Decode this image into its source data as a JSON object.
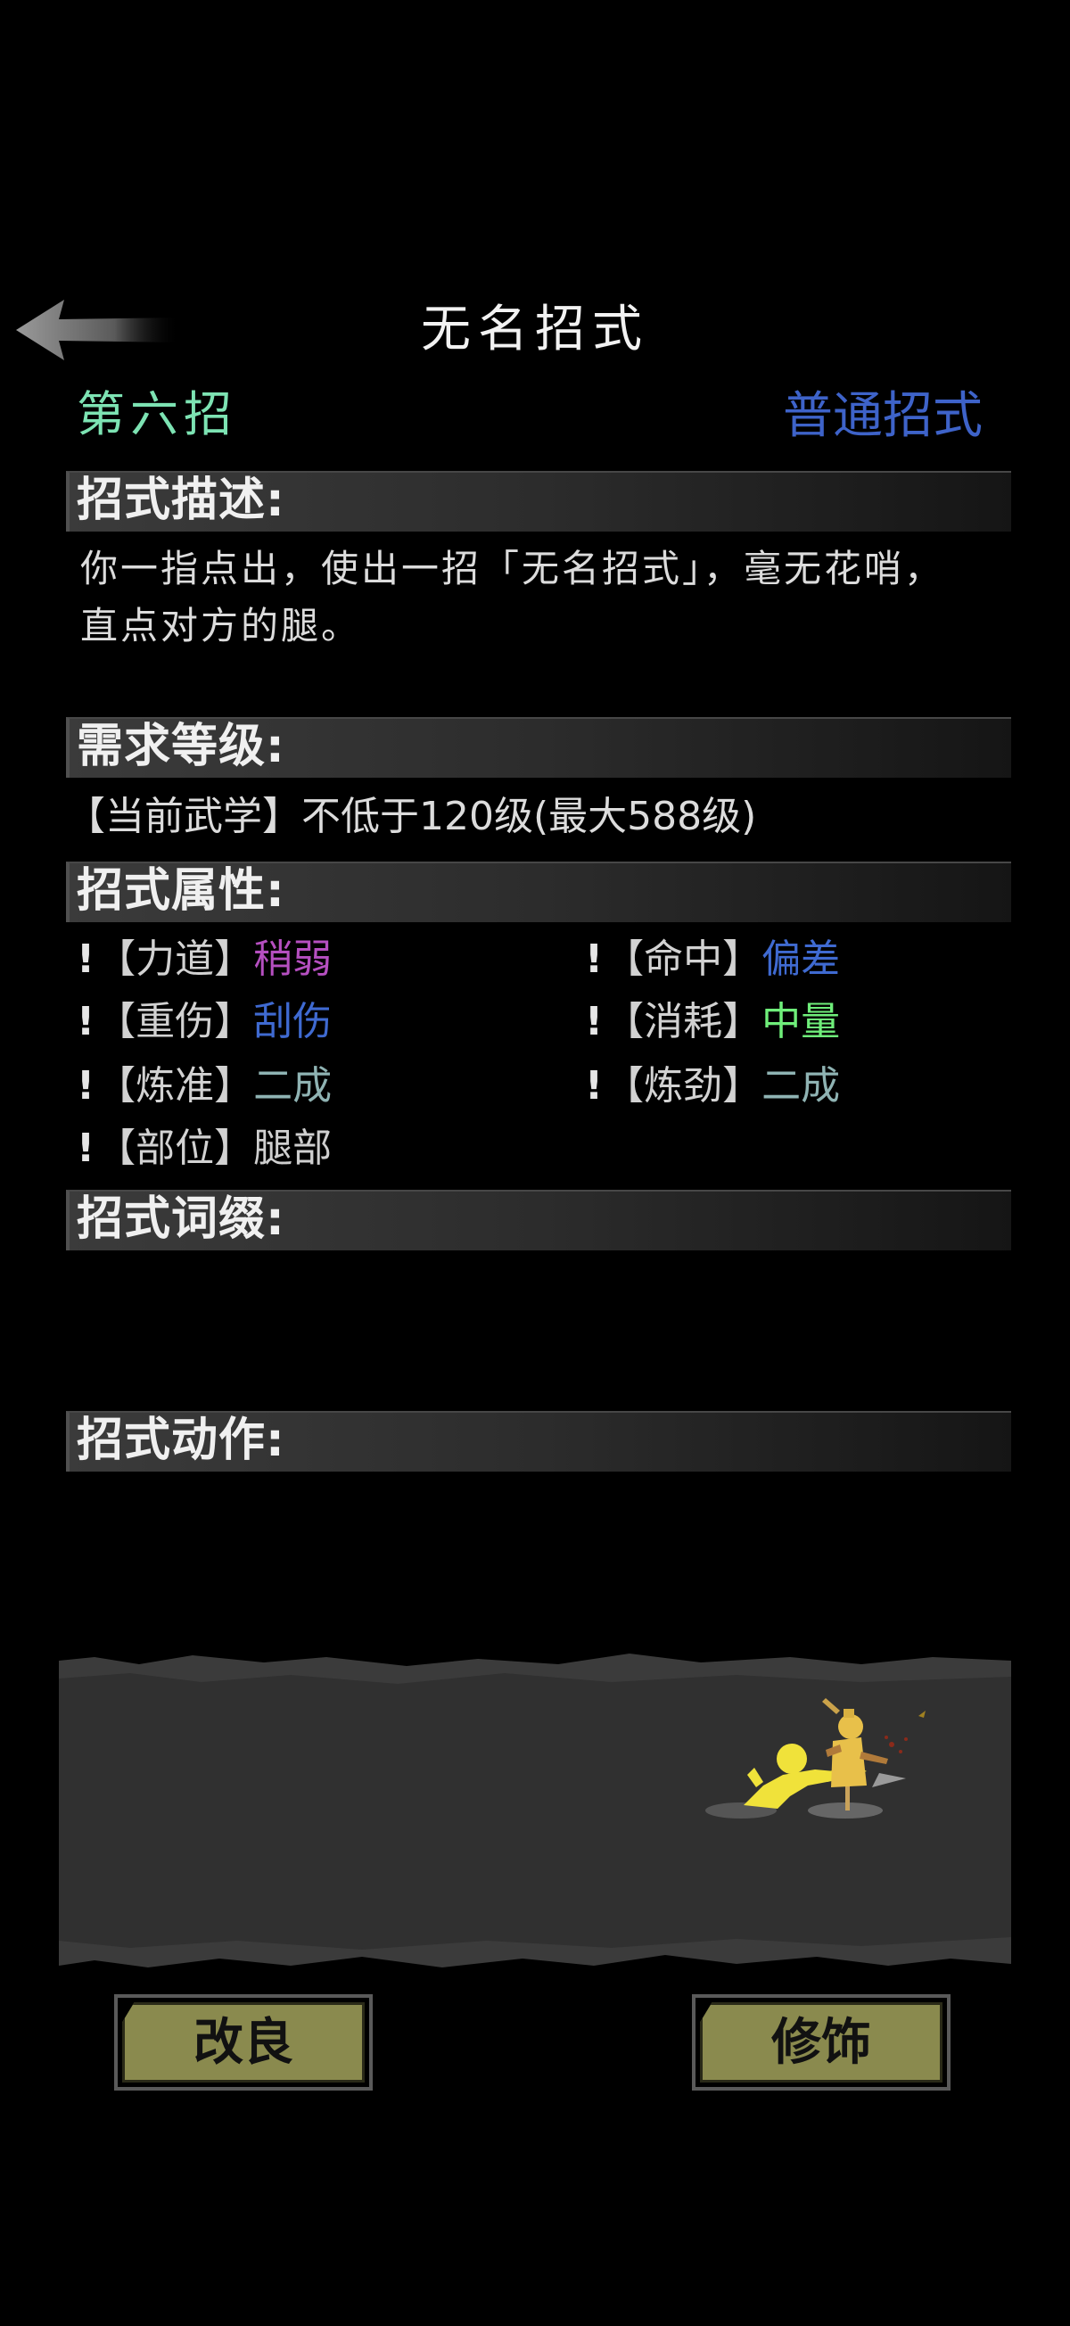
{
  "header": {
    "title": "无名招式",
    "back_icon": "back-arrow-icon"
  },
  "move": {
    "index_label": "第六招",
    "type_label": "普通招式",
    "colors": {
      "index": "#7de3b3",
      "type": "#3e63c9"
    }
  },
  "sections": {
    "description": "招式描述:",
    "level": "需求等级:",
    "attributes": "招式属性:",
    "affixes": "招式词缀:",
    "actions": "招式动作:"
  },
  "description": {
    "line1": "你一指点出，使出一招「无名招式」，毫无花哨，",
    "line2": "直点对方的腿。"
  },
  "level": {
    "text": "【当前武学】不低于120级(最大588级)"
  },
  "attributes": {
    "bang": "!",
    "items": [
      {
        "key": "【力道】",
        "value": "稍弱",
        "color": "#b54fc0"
      },
      {
        "key": "【命中】",
        "value": "偏差",
        "color": "#3f6ad1"
      },
      {
        "key": "【重伤】",
        "value": "刮伤",
        "color": "#3f6ad1"
      },
      {
        "key": "【消耗】",
        "value": "中量",
        "color": "#6fee7a"
      },
      {
        "key": "【炼准】",
        "value": "二成",
        "color": "#8fb3b3"
      },
      {
        "key": "【炼劲】",
        "value": "二成",
        "color": "#8fb3b3"
      },
      {
        "key": "【部位】",
        "value": "腿部",
        "color": "#cfcfcf"
      }
    ]
  },
  "buttons": {
    "improve": "改良",
    "decorate": "修饰"
  }
}
